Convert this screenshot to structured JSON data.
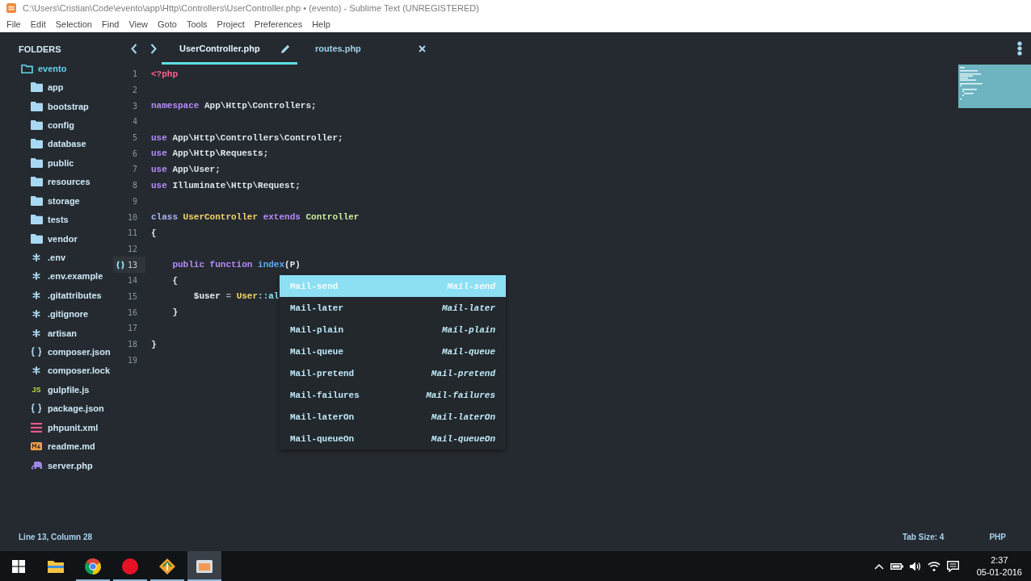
{
  "window": {
    "title": "C:\\Users\\Cristian\\Code\\evento\\app\\Http\\Controllers\\UserController.php • (evento) - Sublime Text (UNREGISTERED)"
  },
  "menu": [
    "File",
    "Edit",
    "Selection",
    "Find",
    "View",
    "Goto",
    "Tools",
    "Project",
    "Preferences",
    "Help"
  ],
  "sidebar": {
    "title": "FOLDERS",
    "tree": [
      {
        "label": "evento",
        "kind": "folder",
        "expanded": true,
        "children": [
          {
            "label": "app",
            "kind": "folder",
            "expanded": false
          },
          {
            "label": "bootstrap",
            "kind": "folder",
            "expanded": false
          },
          {
            "label": "config",
            "kind": "folder",
            "expanded": false
          },
          {
            "label": "database",
            "kind": "folder",
            "expanded": false
          },
          {
            "label": "public",
            "kind": "folder",
            "expanded": false
          },
          {
            "label": "resources",
            "kind": "folder",
            "expanded": false
          },
          {
            "label": "storage",
            "kind": "folder",
            "expanded": false
          },
          {
            "label": "tests",
            "kind": "folder",
            "expanded": false
          },
          {
            "label": "vendor",
            "kind": "folder",
            "expanded": false
          },
          {
            "label": ".env",
            "kind": "config"
          },
          {
            "label": ".env.example",
            "kind": "config"
          },
          {
            "label": ".gitattributes",
            "kind": "config"
          },
          {
            "label": ".gitignore",
            "kind": "config"
          },
          {
            "label": "artisan",
            "kind": "config"
          },
          {
            "label": "composer.json",
            "kind": "json"
          },
          {
            "label": "composer.lock",
            "kind": "config"
          },
          {
            "label": "gulpfile.js",
            "kind": "script",
            "badge": "JS"
          },
          {
            "label": "package.json",
            "kind": "json"
          },
          {
            "label": "phpunit.xml",
            "kind": "xml"
          },
          {
            "label": "readme.md",
            "kind": "markdown"
          },
          {
            "label": "server.php",
            "kind": "php"
          }
        ]
      }
    ]
  },
  "tabs": [
    {
      "label": "UserController.php",
      "selected": true,
      "modified": true
    },
    {
      "label": "routes.php",
      "selected": false,
      "modified": false
    }
  ],
  "editor": {
    "lines": [
      {
        "number": "1",
        "current": false,
        "tokens": [
          {
            "kind": "tag",
            "text": "<?php"
          }
        ]
      },
      {
        "number": "2",
        "current": false
      },
      {
        "number": "3",
        "current": false,
        "tokens": [
          {
            "kind": "keyword",
            "text": "namespace"
          },
          {
            "kind": "plain",
            "text": " App\\Http\\Controllers;"
          }
        ]
      },
      {
        "number": "4",
        "current": false
      },
      {
        "number": "5",
        "current": false,
        "tokens": [
          {
            "kind": "keyword",
            "text": "use"
          },
          {
            "kind": "plain",
            "text": " App\\Http\\Controllers\\Controller;"
          }
        ]
      },
      {
        "number": "6",
        "current": false,
        "tokens": [
          {
            "kind": "keyword",
            "text": "use"
          },
          {
            "kind": "plain",
            "text": " App\\Http\\Requests;"
          }
        ]
      },
      {
        "number": "7",
        "current": false,
        "tokens": [
          {
            "kind": "keyword",
            "text": "use"
          },
          {
            "kind": "plain",
            "text": " App\\User;"
          }
        ]
      },
      {
        "number": "8",
        "current": false,
        "tokens": [
          {
            "kind": "keyword",
            "text": "use"
          },
          {
            "kind": "plain",
            "text": " Illuminate\\Http\\Request;"
          }
        ]
      },
      {
        "number": "9",
        "current": false
      },
      {
        "number": "10",
        "current": false,
        "tokens": [
          {
            "kind": "storage",
            "text": "class "
          },
          {
            "kind": "classname",
            "text": "UserController "
          },
          {
            "kind": "keyword",
            "text": "extends "
          },
          {
            "kind": "inherited",
            "text": "Controller"
          }
        ]
      },
      {
        "number": "11",
        "current": false,
        "tokens": [
          {
            "kind": "plain",
            "text": "{"
          }
        ]
      },
      {
        "number": "12",
        "current": false
      },
      {
        "number": "13",
        "current": true,
        "tokens": [
          {
            "kind": "keyword",
            "text": "    public function "
          },
          {
            "kind": "function",
            "text": "index"
          },
          {
            "kind": "plain",
            "text": "(P)"
          }
        ]
      },
      {
        "number": "14",
        "current": false,
        "tokens": [
          {
            "kind": "plain",
            "text": "    {"
          }
        ]
      },
      {
        "number": "15",
        "current": false,
        "tokens": [
          {
            "kind": "variable",
            "text": "        $user"
          },
          {
            "kind": "operator",
            "text": " = "
          },
          {
            "kind": "classname",
            "text": "User"
          },
          {
            "kind": "method",
            "text": "::al"
          }
        ]
      },
      {
        "number": "16",
        "current": false,
        "tokens": [
          {
            "kind": "plain",
            "text": "    }"
          }
        ]
      },
      {
        "number": "17",
        "current": false
      },
      {
        "number": "18",
        "current": false,
        "tokens": [
          {
            "kind": "plain",
            "text": "}"
          }
        ]
      },
      {
        "number": "19",
        "current": false
      }
    ]
  },
  "autocomplete": {
    "items": [
      {
        "trigger": "Mail-send",
        "hint": "Mail-send",
        "selected": true
      },
      {
        "trigger": "Mail-later",
        "hint": "Mail-later",
        "selected": false
      },
      {
        "trigger": "Mail-plain",
        "hint": "Mail-plain",
        "selected": false
      },
      {
        "trigger": "Mail-queue",
        "hint": "Mail-queue",
        "selected": false
      },
      {
        "trigger": "Mail-pretend",
        "hint": "Mail-pretend",
        "selected": false
      },
      {
        "trigger": "Mail-failures",
        "hint": "Mail-failures",
        "selected": false
      },
      {
        "trigger": "Mail-laterOn",
        "hint": "Mail-laterOn",
        "selected": false
      },
      {
        "trigger": "Mail-queueOn",
        "hint": "Mail-queueOn",
        "selected": false
      }
    ]
  },
  "status_bar": {
    "position": "Line 13, Column 28",
    "tab_size": "Tab Size: 4",
    "syntax": "PHP"
  },
  "taskbar": {
    "apps": [
      {
        "kind": "explorer",
        "running": false,
        "active": false
      },
      {
        "kind": "browser",
        "running": true,
        "active": false
      },
      {
        "kind": "recorder",
        "running": true,
        "active": false
      },
      {
        "kind": "git",
        "running": true,
        "active": false
      },
      {
        "kind": "editor",
        "running": true,
        "active": true
      }
    ],
    "clock": {
      "time": "2:37",
      "date": "05-01-2016"
    }
  }
}
